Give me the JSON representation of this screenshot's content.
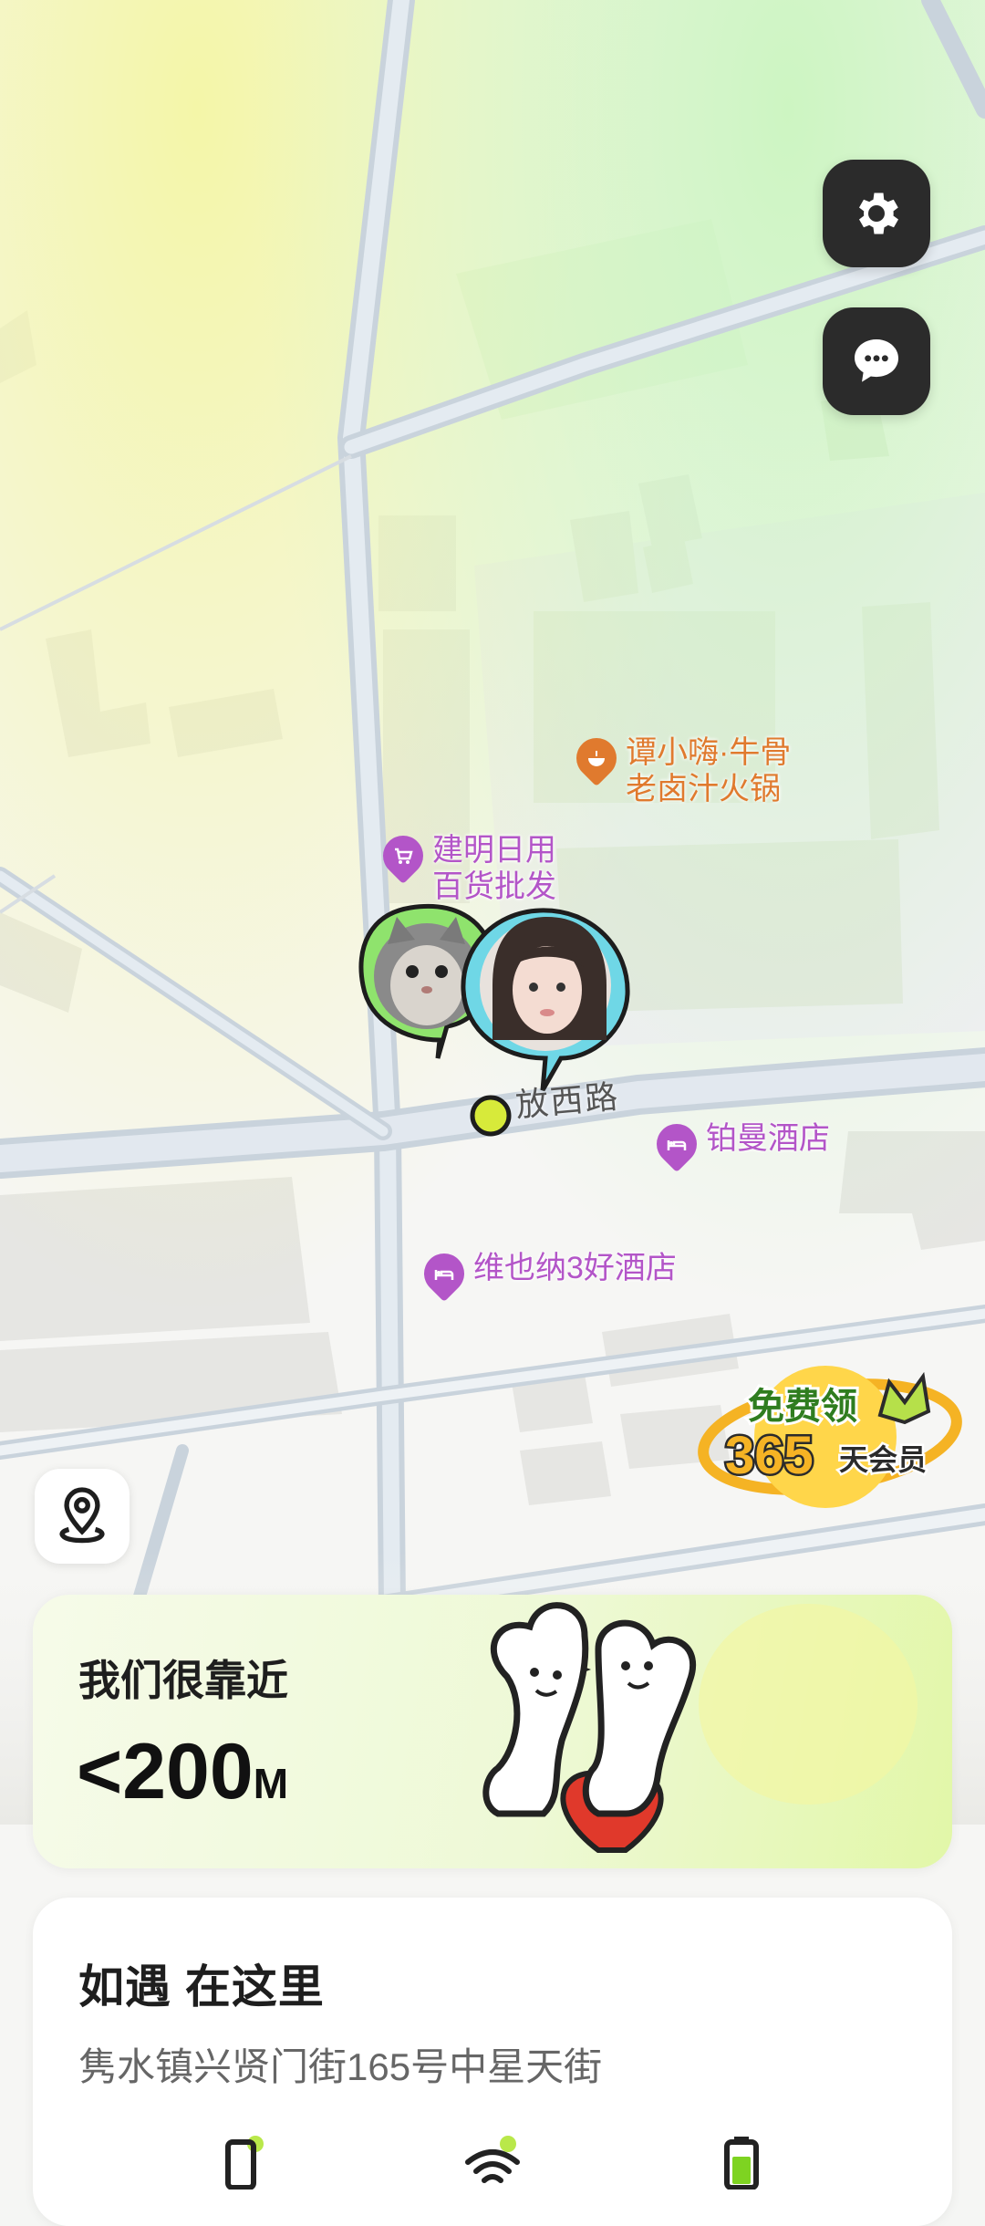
{
  "map": {
    "road_label": "放西路",
    "pois": [
      {
        "name": "谭小嗨·牛骨\n老卤汁火锅",
        "type": "restaurant",
        "color": "#e07a2e"
      },
      {
        "name": "建明日用\n百货批发",
        "type": "shop",
        "color": "#b355c8"
      },
      {
        "name": "铂曼酒店",
        "type": "hotel",
        "color": "#b355c8"
      },
      {
        "name": "维也纳3好酒店",
        "type": "hotel",
        "color": "#b355c8"
      }
    ],
    "avatars": [
      "cat-avatar",
      "girl-avatar"
    ]
  },
  "buttons": {
    "settings_icon": "gear-icon",
    "chat_icon": "chat-bubble-icon",
    "locate_icon": "location-pin-icon"
  },
  "promo": {
    "line1": "免费领",
    "line2": "365",
    "line3": "天会员"
  },
  "near_card": {
    "title": "我们很靠近",
    "distance": "<200",
    "unit": "M"
  },
  "info_card": {
    "title": "如遇 在这里",
    "address": "隽水镇兴贤门街165号中星天街"
  },
  "status": {
    "icons": [
      "phone-icon",
      "wifi-icon",
      "battery-icon"
    ]
  },
  "colors": {
    "accent": "#c5e84a",
    "dark": "#2b2b2b",
    "heart": "#e0392b"
  }
}
